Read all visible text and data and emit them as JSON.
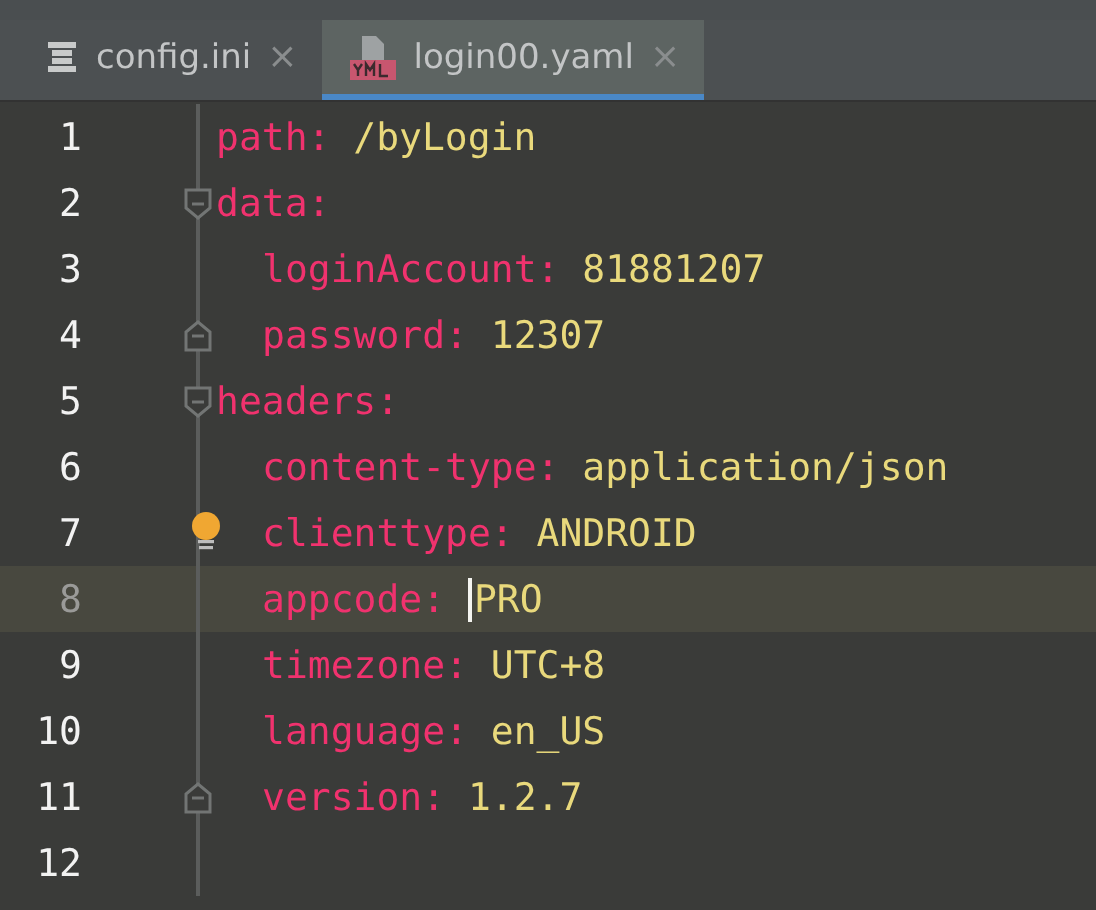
{
  "tabs": [
    {
      "label": "config.ini",
      "kind": "ini",
      "selected": false,
      "close": "×"
    },
    {
      "label": "login00.yaml",
      "kind": "yaml",
      "selected": true,
      "close": "×"
    }
  ],
  "lines": [
    {
      "number": "1",
      "key": "path:",
      "value": "/byLogin",
      "kind": "plain",
      "current": false
    },
    {
      "number": "2",
      "key": "data:",
      "kind": "fold_start",
      "current": false,
      "children": [
        {
          "number": "3",
          "key": "loginAccount:",
          "value": "81881207",
          "kind": "plain",
          "current": false
        },
        {
          "number": "4",
          "key": "password:",
          "value": "12307",
          "kind": "fold_end",
          "current": false
        }
      ]
    },
    {
      "number": "5",
      "key": "headers:",
      "kind": "fold_start",
      "current": false,
      "children": [
        {
          "number": "6",
          "key": "content-type:",
          "value": "application/json",
          "kind": "plain",
          "current": false
        },
        {
          "number": "7",
          "key": "clienttype:",
          "value": "ANDROID",
          "hint": true,
          "kind": "plain",
          "current": false
        },
        {
          "number": "8",
          "key": "appcode:",
          "value": "PRO",
          "caret": true,
          "kind": "plain",
          "current": true
        },
        {
          "number": "9",
          "key": "timezone:",
          "value": "UTC+8",
          "kind": "plain",
          "current": false
        },
        {
          "number": "10",
          "key": "language:",
          "value": "en_US",
          "kind": "plain",
          "current": false
        },
        {
          "number": "11",
          "key": "version:",
          "value": "1.2.7",
          "kind": "fold_end",
          "current": false
        }
      ]
    },
    {
      "number": "12",
      "kind": "plain",
      "current": false
    }
  ]
}
